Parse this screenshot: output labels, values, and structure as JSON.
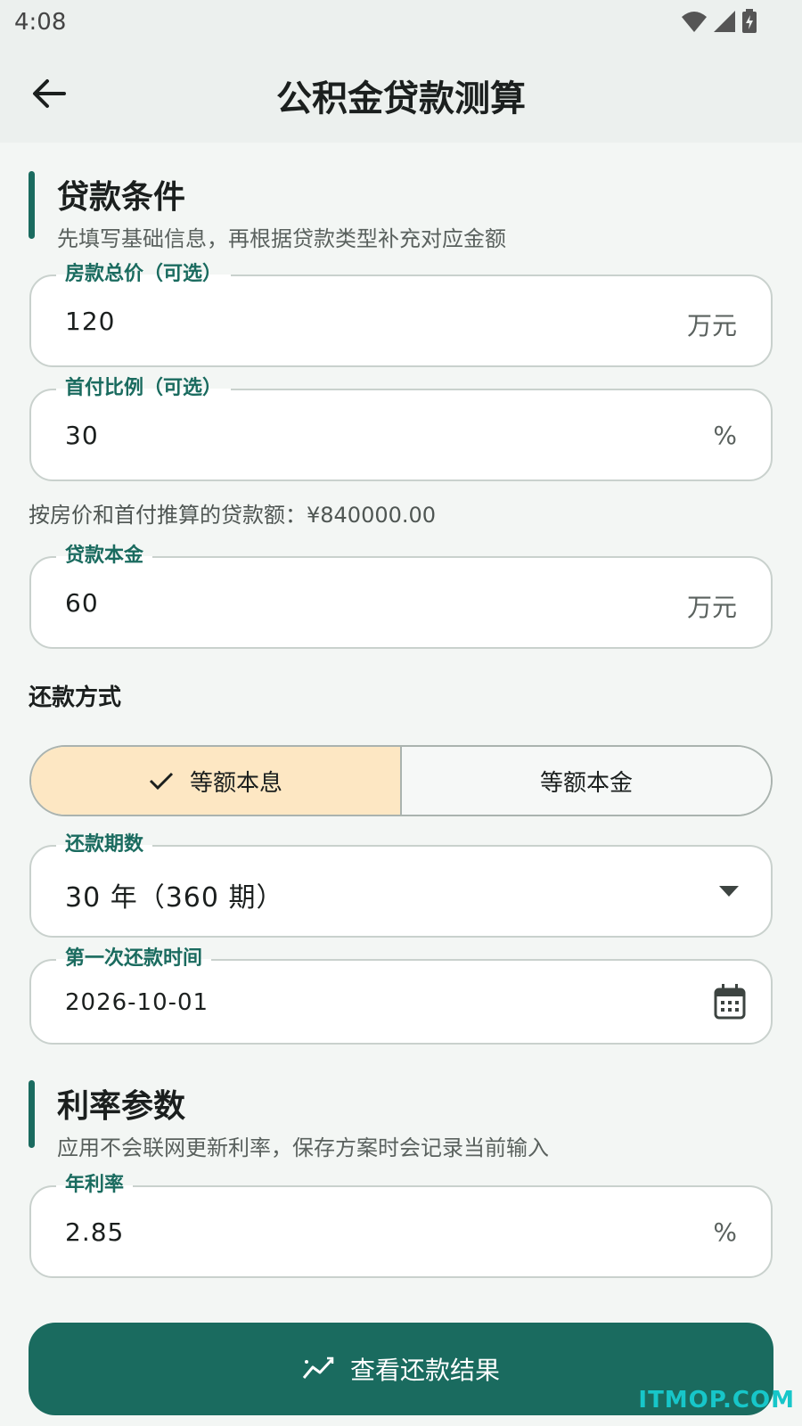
{
  "status_bar": {
    "time": "4:08"
  },
  "appbar": {
    "title": "公积金贷款测算"
  },
  "loan_section": {
    "title": "贷款条件",
    "subtitle": "先填写基础信息，再根据贷款类型补充对应金额"
  },
  "fields": {
    "house_price": {
      "label": "房款总价（可选）",
      "value": "120",
      "suffix": "万元"
    },
    "down_payment": {
      "label": "首付比例（可选）",
      "value": "30",
      "suffix": "%"
    },
    "loan_principal": {
      "label": "贷款本金",
      "value": "60",
      "suffix": "万元"
    },
    "term": {
      "label": "还款期数",
      "value": "30 年（360 期）"
    },
    "first_date": {
      "label": "第一次还款时间",
      "value": "2026-10-01"
    },
    "annual_rate": {
      "label": "年利率",
      "value": "2.85",
      "suffix": "%"
    }
  },
  "helper_text": "按房价和首付推算的贷款额：¥840000.00",
  "repayment": {
    "label": "还款方式",
    "options": [
      "等额本息",
      "等额本金"
    ],
    "selected": "等额本息"
  },
  "rate_section": {
    "title": "利率参数",
    "subtitle": "应用不会联网更新利率，保存方案时会记录当前输入"
  },
  "primary_button": {
    "label": "查看还款结果"
  },
  "watermark": "ITMOP.COM",
  "colors": {
    "accent": "#1a6b5f",
    "selected_segment": "#fde7c3",
    "background": "#f3f6f4"
  }
}
